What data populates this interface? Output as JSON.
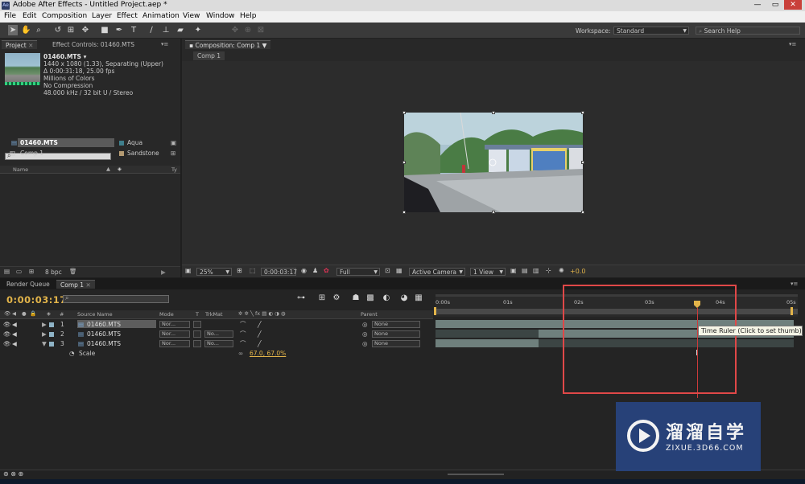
{
  "window": {
    "title": "Adobe After Effects - Untitled Project.aep *",
    "app_icon": "Ae",
    "min": "—",
    "max": "▭",
    "close": "✕"
  },
  "menu": [
    "File",
    "Edit",
    "Composition",
    "Layer",
    "Effect",
    "Animation",
    "View",
    "Window",
    "Help"
  ],
  "toolbar": {
    "workspace_label": "Workspace:",
    "workspace_value": "Standard",
    "search_help_placeholder": "Search Help"
  },
  "project": {
    "tabs": {
      "project": "Project",
      "effect_controls": "Effect Controls: 01460.MTS"
    },
    "asset": {
      "name": "01460.MTS",
      "line1": "1440 x 1080 (1.33), Separating (Upper)",
      "line2": "Δ 0:00:31:18, 25.00 fps",
      "line3": "Millions of Colors",
      "line4": "No Compression",
      "line5": "48.000 kHz / 32 bit U / Stereo"
    },
    "columns": {
      "name": "Name",
      "type": "Ty"
    },
    "items": [
      {
        "name": "01460.MTS",
        "label": "Aqua",
        "color": "#3f7f8c"
      },
      {
        "name": "Comp 1",
        "label": "Sandstone",
        "color": "#b49a72"
      }
    ],
    "footer_bpc": "8 bpc"
  },
  "composition": {
    "tab": "Composition: Comp 1",
    "subtab": "Comp 1",
    "footer": {
      "zoom": "25%",
      "time": "0:00:03:17",
      "resolution": "Full",
      "camera": "Active Camera",
      "views": "1 View",
      "exposure": "+0.0"
    }
  },
  "timeline": {
    "tabs": {
      "render_queue": "Render Queue",
      "comp": "Comp 1"
    },
    "current_time": "0:00:03:17",
    "columns": {
      "number": "#",
      "source_name": "Source Name",
      "mode": "Mode",
      "t": "T",
      "trkmat": "TrkMat",
      "parent": "Parent"
    },
    "layers": [
      {
        "index": "1",
        "name": "01460.MTS",
        "mode": "Nor...",
        "trkmat": "",
        "parent": "None"
      },
      {
        "index": "2",
        "name": "01460.MTS",
        "mode": "Nor...",
        "trkmat": "No...",
        "parent": "None"
      },
      {
        "index": "3",
        "name": "01460.MTS",
        "mode": "Nor...",
        "trkmat": "No...",
        "parent": "None"
      }
    ],
    "scale_property": {
      "label": "Scale",
      "value": "67.0, 67.0%"
    },
    "ruler": [
      "0:00s",
      "01s",
      "02s",
      "03s",
      "04s",
      "05s"
    ],
    "tooltip": "Time Ruler (Click to set thumb)"
  },
  "watermark": {
    "cn": "溜溜自学",
    "url": "ZIXUE.3D66.COM"
  }
}
